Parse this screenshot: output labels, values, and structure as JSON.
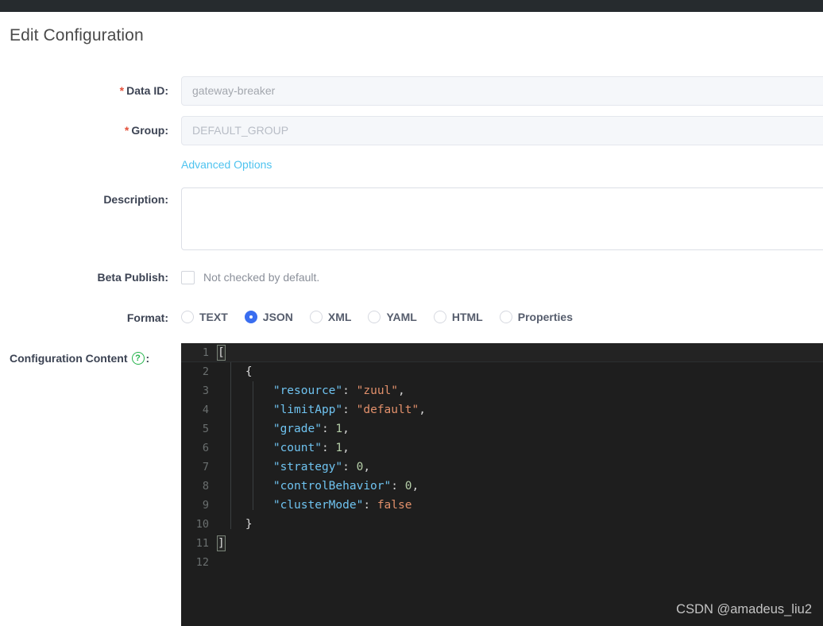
{
  "window": {
    "topbar_color": "#262b2e"
  },
  "page_title": "Edit Configuration",
  "form": {
    "data_id": {
      "label": "Data ID:",
      "required_mark": "*",
      "value": "gateway-breaker"
    },
    "group": {
      "label": "Group:",
      "required_mark": "*",
      "value": "DEFAULT_GROUP"
    },
    "advanced_options_link": "Advanced Options",
    "description": {
      "label": "Description:",
      "value": "",
      "placeholder": ""
    },
    "beta_publish": {
      "label": "Beta Publish:",
      "checked": false,
      "hint": "Not checked by default."
    },
    "format": {
      "label": "Format:",
      "selected": "JSON",
      "options": [
        {
          "label": "TEXT",
          "selected": false
        },
        {
          "label": "JSON",
          "selected": true
        },
        {
          "label": "XML",
          "selected": false
        },
        {
          "label": "YAML",
          "selected": false
        },
        {
          "label": "HTML",
          "selected": false
        },
        {
          "label": "Properties",
          "selected": false
        }
      ]
    },
    "configuration_content": {
      "label": "Configuration Content",
      "help_icon": "question-mark-icon",
      "help_icon_color": "#24b34b",
      "colon": ":"
    }
  },
  "editor": {
    "background": "#1e1e1e",
    "language": "json",
    "line_count": 12,
    "active_line": 1,
    "line_numbers": [
      "1",
      "2",
      "3",
      "4",
      "5",
      "6",
      "7",
      "8",
      "9",
      "10",
      "11",
      "12"
    ],
    "lines": [
      {
        "n": "1",
        "indent": 0,
        "tokens": [
          {
            "t": "[",
            "c": "brace",
            "hl": true
          }
        ]
      },
      {
        "n": "2",
        "indent": 1,
        "tokens": [
          {
            "t": "{",
            "c": "brace"
          }
        ]
      },
      {
        "n": "3",
        "indent": 2,
        "tokens": [
          {
            "t": "\"resource\"",
            "c": "key"
          },
          {
            "t": ": ",
            "c": "punc"
          },
          {
            "t": "\"zuul\"",
            "c": "str"
          },
          {
            "t": ",",
            "c": "punc"
          }
        ]
      },
      {
        "n": "4",
        "indent": 2,
        "tokens": [
          {
            "t": "\"limitApp\"",
            "c": "key"
          },
          {
            "t": ": ",
            "c": "punc"
          },
          {
            "t": "\"default\"",
            "c": "str"
          },
          {
            "t": ",",
            "c": "punc"
          }
        ]
      },
      {
        "n": "5",
        "indent": 2,
        "tokens": [
          {
            "t": "\"grade\"",
            "c": "key"
          },
          {
            "t": ": ",
            "c": "punc"
          },
          {
            "t": "1",
            "c": "num"
          },
          {
            "t": ",",
            "c": "punc"
          }
        ]
      },
      {
        "n": "6",
        "indent": 2,
        "tokens": [
          {
            "t": "\"count\"",
            "c": "key"
          },
          {
            "t": ": ",
            "c": "punc"
          },
          {
            "t": "1",
            "c": "num"
          },
          {
            "t": ",",
            "c": "punc"
          }
        ]
      },
      {
        "n": "7",
        "indent": 2,
        "tokens": [
          {
            "t": "\"strategy\"",
            "c": "key"
          },
          {
            "t": ": ",
            "c": "punc"
          },
          {
            "t": "0",
            "c": "num"
          },
          {
            "t": ",",
            "c": "punc"
          }
        ]
      },
      {
        "n": "8",
        "indent": 2,
        "tokens": [
          {
            "t": "\"controlBehavior\"",
            "c": "key"
          },
          {
            "t": ": ",
            "c": "punc"
          },
          {
            "t": "0",
            "c": "num"
          },
          {
            "t": ",",
            "c": "punc"
          }
        ]
      },
      {
        "n": "9",
        "indent": 2,
        "tokens": [
          {
            "t": "\"clusterMode\"",
            "c": "key"
          },
          {
            "t": ": ",
            "c": "punc"
          },
          {
            "t": "false",
            "c": "bool"
          }
        ]
      },
      {
        "n": "10",
        "indent": 1,
        "tokens": [
          {
            "t": "}",
            "c": "brace"
          }
        ]
      },
      {
        "n": "11",
        "indent": 0,
        "tokens": [
          {
            "t": "]",
            "c": "brace",
            "hl": true
          }
        ]
      },
      {
        "n": "12",
        "indent": 0,
        "tokens": []
      }
    ],
    "raw_content": "[\n    {\n        \"resource\": \"zuul\",\n        \"limitApp\": \"default\",\n        \"grade\": 1,\n        \"count\": 1,\n        \"strategy\": 0,\n        \"controlBehavior\": 0,\n        \"clusterMode\": false\n    }\n]\n"
  },
  "watermark": "CSDN @amadeus_liu2"
}
